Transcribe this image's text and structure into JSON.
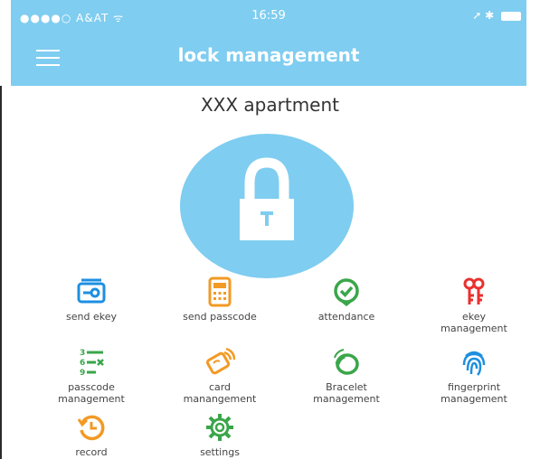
{
  "status_bar": {
    "carrier": "●●●●○  A&AT  ᯤ",
    "time": "16:59",
    "right": "➚ ✱"
  },
  "header": {
    "title": "lock management"
  },
  "apartment": {
    "name": "XXX apartment"
  },
  "features": [
    {
      "label": "send ekey",
      "icon": "ekey-card-icon",
      "color": "#1e8fe0"
    },
    {
      "label": "send passcode",
      "icon": "keypad-icon",
      "color": "#f29a24"
    },
    {
      "label": "attendance",
      "icon": "check-circle-icon",
      "color": "#3aa64a"
    },
    {
      "label": "ekey\nmanagement",
      "icon": "keys-icon",
      "color": "#e8312f"
    },
    {
      "label": "passcode\nmanagement",
      "icon": "numbered-list-icon",
      "color": "#3aa64a"
    },
    {
      "label": "card\nmanangement",
      "icon": "nfc-card-icon",
      "color": "#f29a24"
    },
    {
      "label": "Bracelet\nmanagement",
      "icon": "bracelet-icon",
      "color": "#3aa64a"
    },
    {
      "label": "fingerprint\nmanagement",
      "icon": "fingerprint-icon",
      "color": "#1e8fe0"
    },
    {
      "label": "record",
      "icon": "history-clock-icon",
      "color": "#f29a24"
    },
    {
      "label": "settings",
      "icon": "gear-icon",
      "color": "#3aa64a"
    }
  ]
}
